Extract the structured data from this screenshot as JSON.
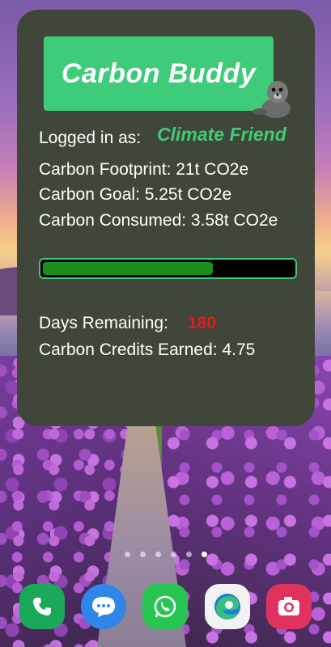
{
  "widget": {
    "title": "Carbon Buddy",
    "logged_in_label": "Logged in as:",
    "user_name": "Climate Friend",
    "footprint": "Carbon Footprint: 21t CO2e",
    "goal": "Carbon Goal: 5.25t CO2e",
    "consumed": "Carbon Consumed: 3.58t CO2e",
    "progress_fraction": 0.68,
    "days_label": "Days Remaining:",
    "days_value": "180",
    "credits": "Carbon Credits Earned: 4.75"
  },
  "home": {
    "page_count": 6,
    "active_page": 5
  },
  "dock": {
    "apps": [
      "phone-icon",
      "messages-icon",
      "whatsapp-icon",
      "edge-browser-icon",
      "camera-icon"
    ]
  },
  "colors": {
    "widget_bg": "#40463a",
    "accent_green": "#3ecb7a",
    "progress_fill": "#1a8f1a",
    "days_red": "#e21b1b"
  }
}
